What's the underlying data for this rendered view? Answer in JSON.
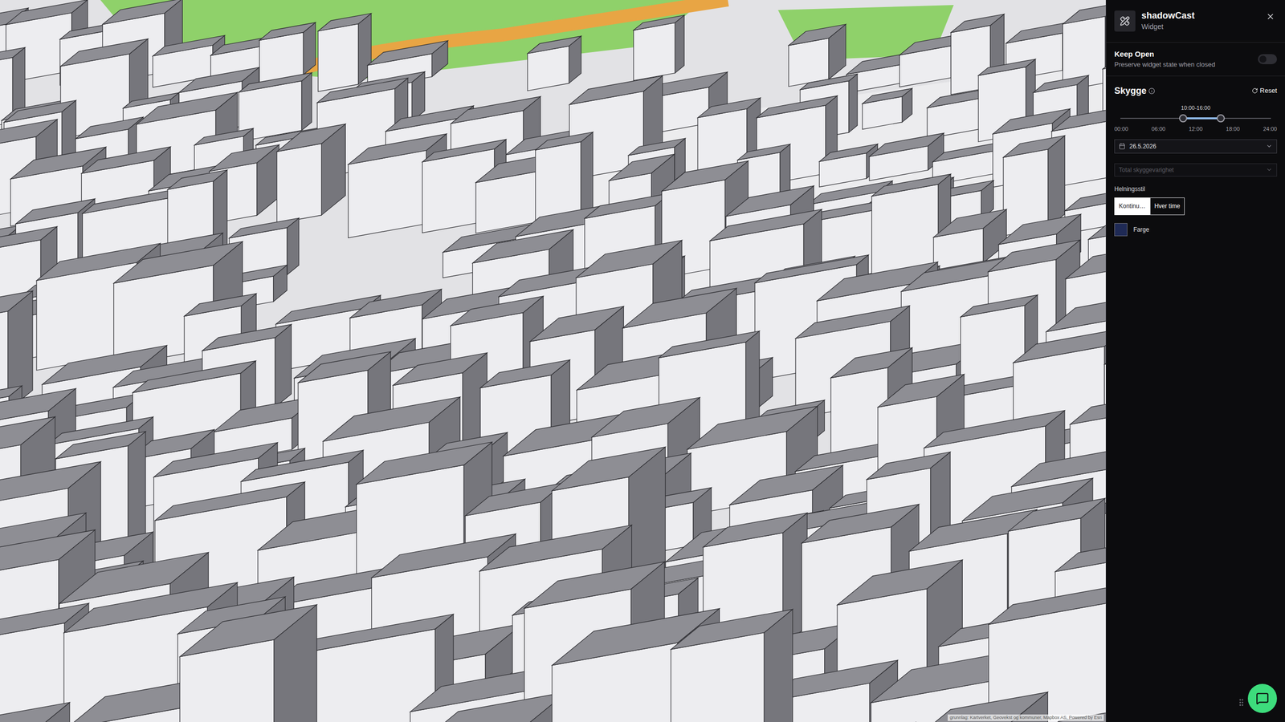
{
  "map": {
    "attribution": "grunnlag: Kartverket, Geovekst og kommuner, Mapbox AS, Powered by Esri"
  },
  "widget": {
    "title": "shadowCast",
    "subtitle": "Widget"
  },
  "keep_open": {
    "label": "Keep Open",
    "description": "Preserve widget state when closed",
    "on": false
  },
  "shadow": {
    "title": "Skygge",
    "reset": "Reset",
    "range_label": "10:00-16:00",
    "range": {
      "level_start": 0.4167,
      "level_end": 0.6667
    },
    "ticks": [
      "00:00",
      "06:00",
      "12:00",
      "18:00",
      "24:00"
    ],
    "date": "26.5.2026",
    "duration": {
      "placeholder": "Total skyggevarighet",
      "disabled": true
    },
    "style": {
      "label": "Helningsstil",
      "options": [
        {
          "label": "Kontinu…",
          "selected": true
        },
        {
          "label": "Hver time",
          "selected": false
        }
      ]
    },
    "color": {
      "label": "Farge",
      "value": "#1f2a55"
    }
  }
}
